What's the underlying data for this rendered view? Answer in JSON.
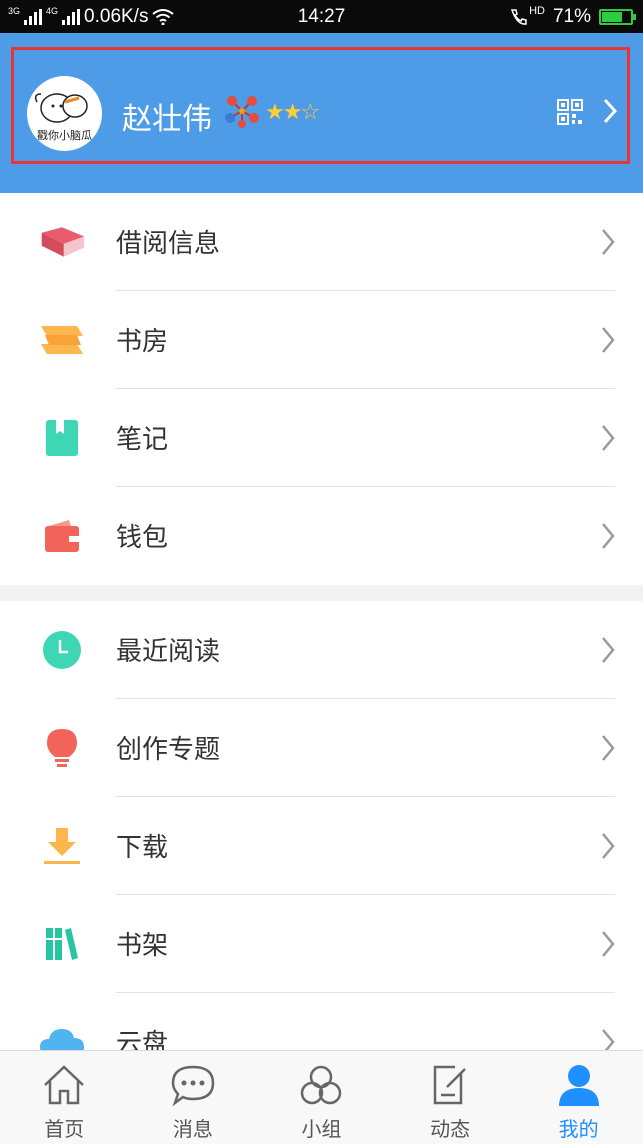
{
  "statusbar": {
    "network_1": "3G",
    "network_2": "4G",
    "speed": "0.06K/s",
    "time": "14:27",
    "hd": "HD",
    "battery": "71%",
    "battery_level": 0.71
  },
  "profile": {
    "name": "赵壮伟",
    "avatar_caption": "戳你小脑瓜",
    "stars": "★★☆",
    "star_rating": 2,
    "accent_color": "#4e9be8"
  },
  "group1": [
    {
      "label": "借阅信息",
      "icon": "book-icon"
    },
    {
      "label": "书房",
      "icon": "study-icon"
    },
    {
      "label": "笔记",
      "icon": "note-icon"
    },
    {
      "label": "钱包",
      "icon": "wallet-icon"
    }
  ],
  "group2": [
    {
      "label": "最近阅读",
      "icon": "clock-icon"
    },
    {
      "label": "创作专题",
      "icon": "lightbulb-icon"
    },
    {
      "label": "下载",
      "icon": "download-icon"
    },
    {
      "label": "书架",
      "icon": "bookshelf-icon"
    },
    {
      "label": "云盘",
      "icon": "cloud-icon"
    }
  ],
  "tabs": [
    {
      "label": "首页",
      "icon": "home-icon"
    },
    {
      "label": "消息",
      "icon": "message-icon"
    },
    {
      "label": "小组",
      "icon": "group-icon"
    },
    {
      "label": "动态",
      "icon": "feed-icon"
    },
    {
      "label": "我的",
      "icon": "me-icon",
      "active": true
    }
  ]
}
